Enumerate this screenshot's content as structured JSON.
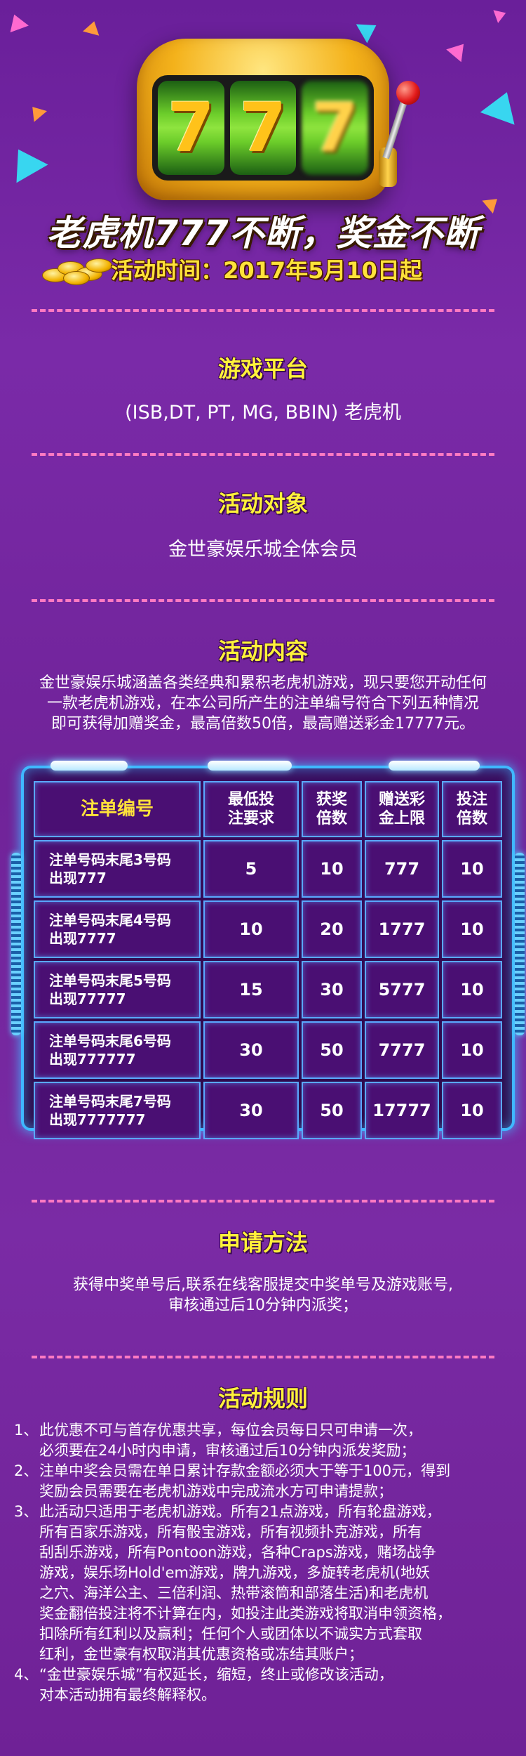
{
  "hero": {
    "reels": [
      "7",
      "7",
      "7"
    ],
    "title": "老虎机777不断，奖金不断",
    "date": "活动时间：2017年5月10日起"
  },
  "sections": {
    "platform": {
      "title": "游戏平台",
      "text": "(ISB,DT, PT, MG, BBIN) 老虎机"
    },
    "target": {
      "title": "活动对象",
      "text": "金世豪娱乐城全体会员"
    },
    "content": {
      "title": "活动内容",
      "lines": [
        "金世豪娱乐城涵盖各类经典和累积老虎机游戏，现只要您开动任何",
        "一款老虎机游戏，在本公司所产生的注单编号符合下列五种情况",
        "即可获得加赠奖金，最高倍数50倍，最高赠送彩金17777元。"
      ]
    },
    "apply": {
      "title": "申请方法",
      "lines": [
        "获得中奖单号后,联系在线客服提交中奖单号及游戏账号,",
        "审核通过后10分钟内派奖；"
      ]
    },
    "rules": {
      "title": "活动规则",
      "items": [
        {
          "num": "1、",
          "lines": [
            "此优惠不可与首存优惠共享，每位会员每日只可申请一次，",
            "必须要在24小时内申请，审核通过后10分钟内派发奖励；"
          ]
        },
        {
          "num": "2、",
          "lines": [
            "注单中奖会员需在单日累计存款金额必须大于等于100元，得到",
            "奖励会员需要在老虎机游戏中完成流水方可申请提款；"
          ]
        },
        {
          "num": "3、",
          "lines": [
            "此活动只适用于老虎机游戏。所有21点游戏，所有轮盘游戏，",
            "所有百家乐游戏，所有骰宝游戏，所有视频扑克游戏，所有",
            "刮刮乐游戏，所有Pontoon游戏，各种Craps游戏，赌场战争",
            "游戏，娱乐场Hold'em游戏，牌九游戏，多旋转老虎机(地妖",
            "之穴、海洋公主、三倍利润、热带滚筒和部落生活)和老虎机",
            "奖金翻倍投注将不计算在内，如投注此类游戏将取消申领资格，",
            "扣除所有红利以及赢利；任何个人或团体以不诚实方式套取",
            "红利，金世豪有权取消其优惠资格或冻结其账户；"
          ]
        },
        {
          "num": "4、",
          "lines": [
            "“金世豪娱乐城”有权延长，缩短，终止或修改该活动，",
            "对本活动拥有最终解释权。"
          ]
        }
      ]
    }
  },
  "table": {
    "headers": [
      {
        "lines": [
          "注单编号"
        ]
      },
      {
        "lines": [
          "最低投",
          "注要求"
        ]
      },
      {
        "lines": [
          "获奖",
          "倍数"
        ]
      },
      {
        "lines": [
          "赠送彩",
          "金上限"
        ]
      },
      {
        "lines": [
          "投注",
          "倍数"
        ]
      }
    ],
    "rows": [
      {
        "cond": [
          "注单号码末尾3号码",
          "出现777"
        ],
        "min": "5",
        "mult": "10",
        "cap": "777",
        "bet": "10"
      },
      {
        "cond": [
          "注单号码末尾4号码",
          "出现7777"
        ],
        "min": "10",
        "mult": "20",
        "cap": "1777",
        "bet": "10"
      },
      {
        "cond": [
          "注单号码末尾5号码",
          "出现77777"
        ],
        "min": "15",
        "mult": "30",
        "cap": "5777",
        "bet": "10"
      },
      {
        "cond": [
          "注单号码末尾6号码",
          "出现777777"
        ],
        "min": "30",
        "mult": "50",
        "cap": "7777",
        "bet": "10"
      },
      {
        "cond": [
          "注单号码末尾7号码",
          "出现7777777"
        ],
        "min": "30",
        "mult": "50",
        "cap": "17777",
        "bet": "10"
      }
    ]
  },
  "colors": {
    "heading": "#fff23a",
    "divider": "#ff7ac2",
    "table_border": "#3fb8ff"
  },
  "icons": [
    "slot-machine-icon",
    "lever-icon",
    "gold-coins-icon"
  ]
}
